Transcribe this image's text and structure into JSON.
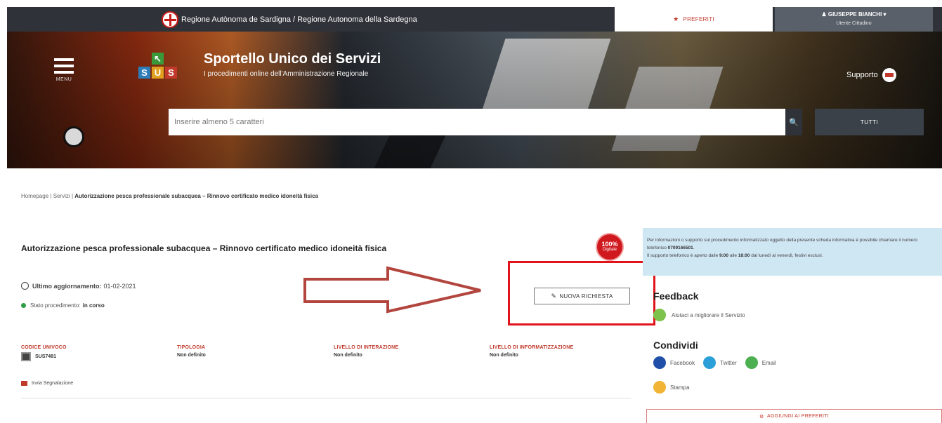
{
  "header": {
    "region_label": "Regione Autònoma de Sardigna / Regione Autonoma della Sardegna",
    "favorites_label": "PREFERITI",
    "user_name": "GIUSEPPE BIANCHI",
    "user_role": "Utente Cittadino"
  },
  "hero": {
    "menu_label": "MENU",
    "logo_letters": [
      "S",
      "U",
      "S"
    ],
    "site_title": "Sportello Unico dei Servizi",
    "site_subtitle": "I procedimenti online dell'Amministrazione Regionale",
    "support_label": "Supporto",
    "search_placeholder": "Inserire almeno 5 caratteri",
    "filter_label": "TUTTI"
  },
  "breadcrumb": {
    "home": "Homepage",
    "sep": "|",
    "services": "Servizi",
    "current": "Autorizzazione pesca professionale subacquea – Rinnovo certificato medico idoneità fisica"
  },
  "procedure": {
    "title": "Autorizzazione pesca professionale subacquea – Rinnovo certificato medico idoneità fisica",
    "badge_value": "100%",
    "badge_sub": "Digitale",
    "last_update_label": "Ultimo aggiornamento:",
    "last_update_value": "01-02-2021",
    "state_label": "Stato procedimento:",
    "state_value": "in corso",
    "new_request_label": "NUOVA RICHIESTA",
    "columns": [
      {
        "header": "CODICE UNIVOCO",
        "value": "SUS7481"
      },
      {
        "header": "TIPOLOGIA",
        "value": "Non definito"
      },
      {
        "header": "LIVELLO DI INTERAZIONE",
        "value": "Non definito"
      },
      {
        "header": "LIVELLO DI INFORMATIZZAZIONE",
        "value": "Non definito"
      }
    ],
    "report_label": "Invia Segnalazione"
  },
  "sidebar": {
    "info_line1": "Per informazioni o supporto sul procedimento informatizzato oggetto della presente scheda informativa è possibile chiamare il numero telefonico",
    "info_phone": "0709166501",
    "info_line2": "Il supporto telefonico è aperto dalle",
    "info_from": "9:00",
    "info_mid": "alle",
    "info_to": "18:00",
    "info_line3": "dal lunedì al venerdì, festivi esclusi.",
    "feedback_title": "Feedback",
    "feedback_link": "Aiutaci a migliorare il Servizio",
    "share_title": "Condividi",
    "share_items": [
      {
        "label": "Facebook",
        "color": "#1f4fa8"
      },
      {
        "label": "Twitter",
        "color": "#2a9fd8"
      },
      {
        "label": "Email",
        "color": "#4caf50"
      }
    ],
    "print_label": "Stampa",
    "add_favorites_label": "AGGIUNGI AI PREFERITI"
  }
}
